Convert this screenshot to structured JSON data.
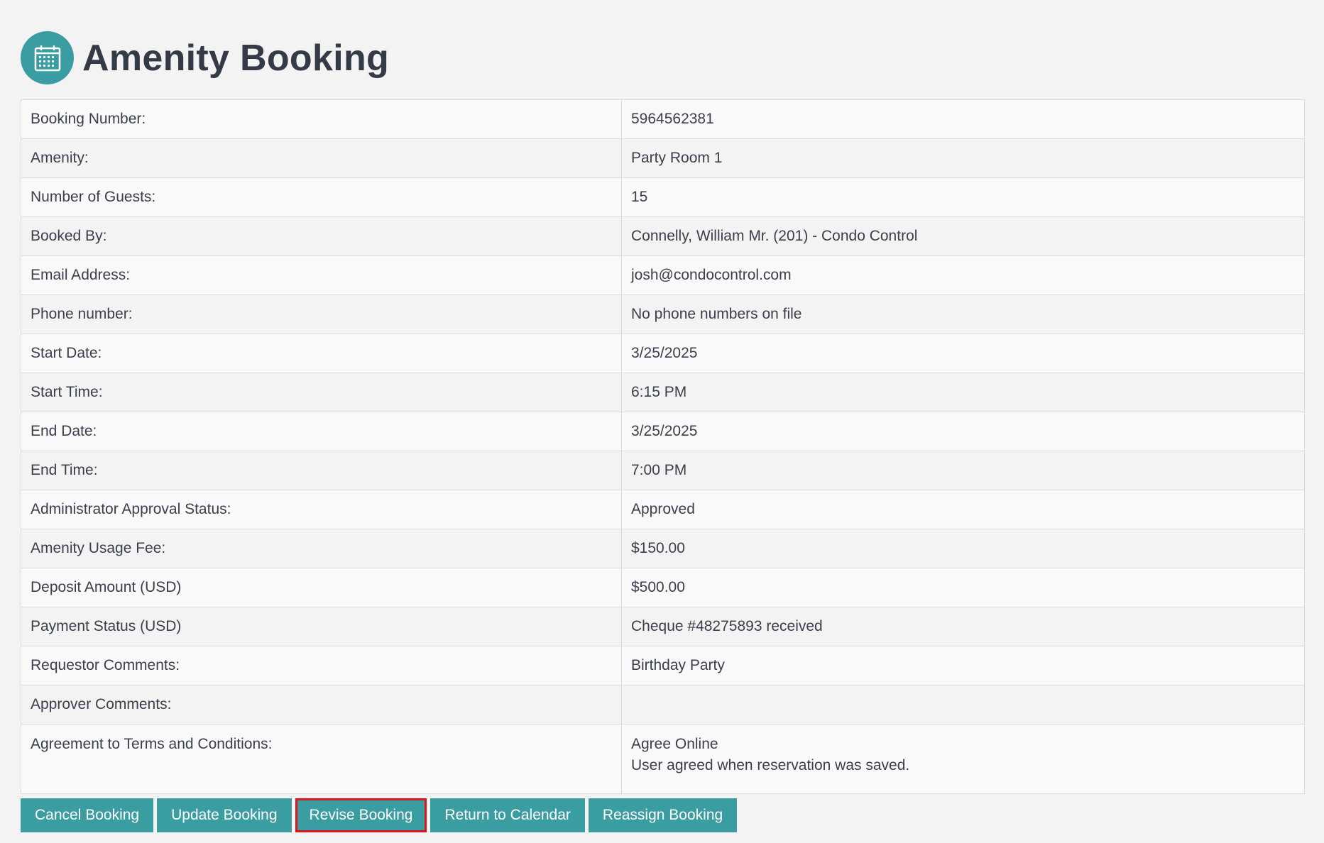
{
  "page": {
    "title": "Amenity Booking",
    "icon": "calendar-icon",
    "accent_color": "#3a9da2",
    "highlight_color": "#d9141b"
  },
  "details": [
    {
      "label": "Booking Number:",
      "value": "5964562381"
    },
    {
      "label": "Amenity:",
      "value": "Party Room 1"
    },
    {
      "label": "Number of Guests:",
      "value": "15"
    },
    {
      "label": "Booked By:",
      "value": "Connelly, William Mr. (201) - Condo Control"
    },
    {
      "label": "Email Address:",
      "value": "josh@condocontrol.com"
    },
    {
      "label": "Phone number:",
      "value": "No phone numbers on file"
    },
    {
      "label": "Start Date:",
      "value": "3/25/2025"
    },
    {
      "label": "Start Time:",
      "value": "6:15 PM"
    },
    {
      "label": "End Date:",
      "value": "3/25/2025"
    },
    {
      "label": "End Time:",
      "value": "7:00 PM"
    },
    {
      "label": "Administrator Approval Status:",
      "value": "Approved"
    },
    {
      "label": "Amenity Usage Fee:",
      "value": "$150.00"
    },
    {
      "label": "Deposit Amount (USD)",
      "value": "$500.00"
    },
    {
      "label": "Payment Status (USD)",
      "value": "Cheque #48275893 received"
    },
    {
      "label": "Requestor Comments:",
      "value": "Birthday Party"
    },
    {
      "label": "Approver Comments:",
      "value": ""
    },
    {
      "label": "Agreement to Terms and Conditions:",
      "value": "Agree Online",
      "value_line2": "User agreed when reservation was saved."
    }
  ],
  "buttons": {
    "cancel": "Cancel Booking",
    "update": "Update Booking",
    "revise": "Revise Booking",
    "return": "Return to Calendar",
    "reassign": "Reassign Booking"
  }
}
